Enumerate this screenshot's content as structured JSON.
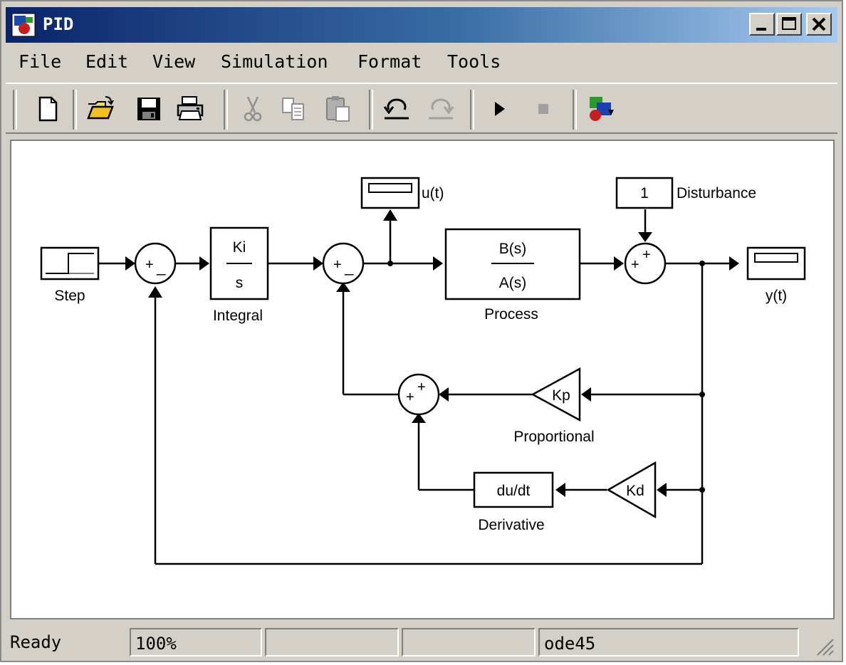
{
  "window": {
    "title": "PID"
  },
  "menu": [
    "File",
    "Edit",
    "View",
    "Simulation",
    "Format",
    "Tools"
  ],
  "toolbar": [
    "new-icon",
    "open-icon",
    "save-icon",
    "print-icon",
    "cut-icon",
    "copy-icon",
    "paste-icon",
    "undo-icon",
    "redo-icon",
    "run-icon",
    "stop-icon",
    "library-browser-icon"
  ],
  "diagram": {
    "step_label": "Step",
    "integral": {
      "num": "Ki",
      "den": "s",
      "label": "Integral"
    },
    "process": {
      "num": "B(s)",
      "den": "A(s)",
      "label": "Process"
    },
    "scope_u": "u(t)",
    "scope_y": "y(t)",
    "disturbance": {
      "value": "1",
      "label": "Disturbance"
    },
    "kp": "Kp",
    "kp_label": "Proportional",
    "kd": "Kd",
    "derivative": {
      "text": "du/dt",
      "label": "Derivative"
    }
  },
  "status": {
    "ready": "Ready",
    "zoom": "100%",
    "blank1": "",
    "blank2": "",
    "solver": "ode45"
  }
}
